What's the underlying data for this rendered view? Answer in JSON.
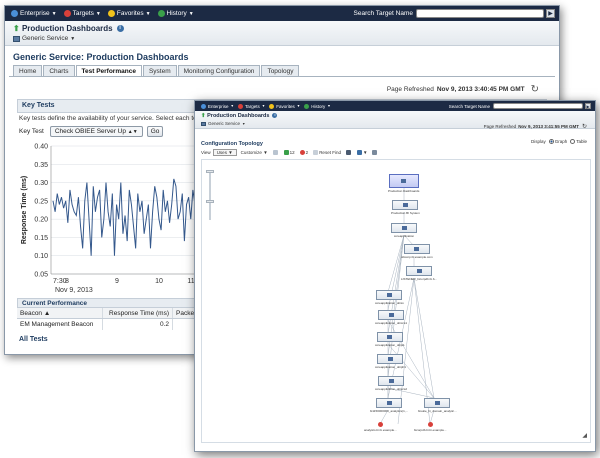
{
  "back_window": {
    "menu": [
      "Enterprise",
      "Targets",
      "Favorites",
      "History"
    ],
    "search_label": "Search Target Name",
    "page_title": "Production Dashboards",
    "service_menu": "Generic Service",
    "section_title": "Generic Service: Production Dashboards",
    "tabs": [
      "Home",
      "Charts",
      "Test Performance",
      "System",
      "Monitoring Configuration",
      "Topology"
    ],
    "active_tab": "Test Performance",
    "refresh_label": "Page Refreshed",
    "refresh_time": "Nov 9, 2013 3:40:45 PM GMT",
    "key_tests": {
      "title": "Key Tests",
      "description": "Key tests define the availability of your service. Select each test to see",
      "label": "Key Test",
      "selected": "Check OBIEE Server Up",
      "go": "Go"
    },
    "current_performance": {
      "title": "Current Performance",
      "columns": [
        "Beacon",
        "Response Time (ms)",
        "Packetl"
      ],
      "rows": [
        [
          "EM Management Beacon",
          "0.2",
          ""
        ]
      ]
    },
    "all_tests": "All Tests"
  },
  "chart_data": {
    "type": "line",
    "ylabel": "Response Time (ms)",
    "ylim": [
      0.05,
      0.4
    ],
    "yticks": [
      "0.40",
      "0.35",
      "0.30",
      "0.25",
      "0.20",
      "0.15",
      "0.10",
      "0.05"
    ],
    "xticks": [
      "7:30",
      "8",
      "9",
      "10",
      "11"
    ],
    "xlabel_sub": "Nov 9, 2013",
    "color": "#34588c",
    "series": [
      {
        "values": [
          0.25,
          0.22,
          0.27,
          0.24,
          0.26,
          0.23,
          0.25,
          0.19,
          0.28,
          0.24,
          0.22,
          0.21,
          0.26,
          0.18,
          0.12,
          0.25,
          0.3,
          0.2,
          0.1,
          0.29,
          0.22,
          0.26,
          0.28,
          0.15,
          0.2,
          0.3,
          0.22,
          0.18,
          0.27,
          0.1,
          0.24,
          0.2,
          0.3,
          0.16,
          0.21,
          0.14,
          0.28,
          0.24,
          0.18,
          0.12,
          0.27,
          0.22,
          0.25,
          0.16,
          0.2,
          0.24,
          0.12,
          0.22,
          0.29,
          0.26,
          0.2,
          0.17,
          0.28,
          0.22,
          0.25,
          0.19,
          0.24,
          0.31,
          0.29,
          0.2,
          0.22,
          0.27,
          0.14,
          0.24,
          0.26,
          0.2,
          0.28,
          0.24
        ]
      }
    ]
  },
  "front_window": {
    "menu": [
      "Enterprise",
      "Targets",
      "Favorites",
      "History"
    ],
    "search_label": "Search Target Name",
    "page_title": "Production Dashboards",
    "service_menu": "Generic Service",
    "refresh_label": "Page Refreshed",
    "refresh_time": "Nov 9, 2013 3:41:55 PM GMT",
    "topology_title": "Configuration Topology",
    "display_label": "Display",
    "display_options": [
      "Graph",
      "Table"
    ],
    "view_label": "View",
    "view_value": "Uses",
    "customize": "Customize",
    "count_up": "12",
    "count_down": "2",
    "reset_find": "Reset Find",
    "nodes": [
      "Production Dashboards",
      "Production BI System",
      "coreapplication",
      "obicorp.bi.example.com",
      "LISTENER_bicorpdb.bi.b...",
      "coreapplication_obisv",
      "coreapplication_obiccs1",
      "coreapplication_obijs1",
      "coreapplication_obiph1",
      "coreapplication_obiccs2",
      "bi1150000000_analytics(1,...",
      "bisuite_bi_domain_analytic...",
      "analytics.bi.bi.example...",
      "bicorpdb.bi.bi.example..."
    ]
  }
}
